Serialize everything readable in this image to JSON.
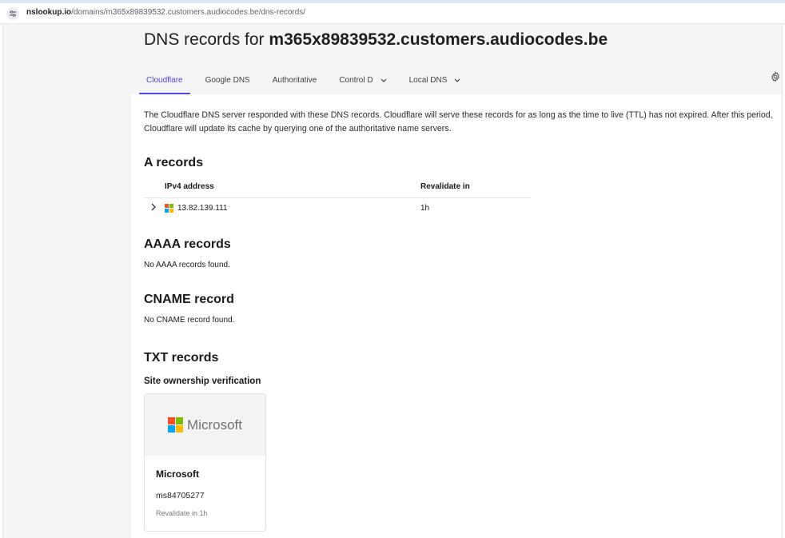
{
  "browser": {
    "url_host": "nslookup.io",
    "url_path": "/domains/m365x89839532.customers.audiocodes.be/dns-records/"
  },
  "page": {
    "title_prefix": "DNS records for",
    "title_domain": "m365x89839532.customers.audiocodes.be"
  },
  "tabs": [
    {
      "label": "Cloudflare",
      "active": true
    },
    {
      "label": "Google DNS"
    },
    {
      "label": "Authoritative"
    },
    {
      "label": "Control D"
    },
    {
      "label": "Local DNS"
    }
  ],
  "intro": "The Cloudflare DNS server responded with these DNS records. Cloudflare will serve these records for as long as the time to live (TTL) has not expired. After this period, Cloudflare will update its cache by querying one of the authoritative name servers.",
  "a_records": {
    "heading": "A records",
    "columns": [
      "IPv4 address",
      "Revalidate in"
    ],
    "rows": [
      {
        "ip": "13.82.139.111",
        "revalidate": "1h",
        "provider_icon": "microsoft-logo-icon"
      }
    ]
  },
  "aaaa_records": {
    "heading": "AAAA records",
    "empty": "No AAAA records found."
  },
  "cname_record": {
    "heading": "CNAME record",
    "empty": "No CNAME record found."
  },
  "txt_records": {
    "heading": "TXT records",
    "subheading": "Site ownership verification",
    "cards": [
      {
        "logo_text": "Microsoft",
        "name": "Microsoft",
        "value": "ms84705277",
        "revalidate": "Revalidate in 1h"
      }
    ]
  },
  "colors": {
    "accent": "#4f46e5",
    "ms_red": "#f25022",
    "ms_green": "#7fba00",
    "ms_blue": "#00a4ef",
    "ms_yellow": "#ffb900"
  },
  "icons": [
    "site-settings-icon",
    "chevron-down-icon",
    "expand-chevron-icon",
    "settings-gear-icon",
    "microsoft-logo-icon"
  ]
}
